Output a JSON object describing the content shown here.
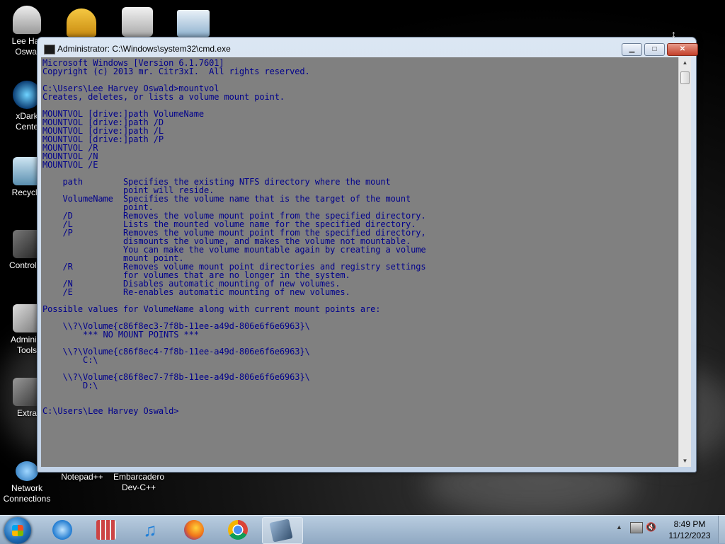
{
  "desktop": {
    "icons": [
      {
        "label": "Lee Har\nOswal",
        "icon": "user-folder-icon",
        "color": "#e6e6e6"
      },
      {
        "label": "xDark\nCente",
        "icon": "xdark-center-icon",
        "color": "#2a9bd6"
      },
      {
        "label": "Recycle",
        "icon": "recycle-bin-icon",
        "color": "#6aa9c9"
      },
      {
        "label": "Control P",
        "icon": "control-panel-icon",
        "color": "#444444"
      },
      {
        "label": "Administ\nTools",
        "icon": "admin-tools-icon",
        "color": "#888888"
      },
      {
        "label": "Extra",
        "icon": "extra-folder-icon",
        "color": "#555555"
      },
      {
        "label": "Network\nConnections",
        "icon": "network-connections-icon",
        "color": "#3c8fd6"
      },
      {
        "label": "Notepad++",
        "icon": "notepad-plus-plus-icon",
        "color": "#7cc576"
      },
      {
        "label": "Embarcadero\nDev-C++",
        "icon": "dev-cpp-icon",
        "color": "#d43c3c"
      }
    ]
  },
  "window": {
    "title": "Administrator: C:\\Windows\\system32\\cmd.exe",
    "minimize_label": "▁",
    "maximize_label": "□",
    "close_label": "✕"
  },
  "console": {
    "text": "Microsoft Windows [Version 6.1.7601]\nCopyright (c) 2013 mr. Citr3xI.  All rights reserved.\n\nC:\\Users\\Lee Harvey Oswald>mountvol\nCreates, deletes, or lists a volume mount point.\n\nMOUNTVOL [drive:]path VolumeName\nMOUNTVOL [drive:]path /D\nMOUNTVOL [drive:]path /L\nMOUNTVOL [drive:]path /P\nMOUNTVOL /R\nMOUNTVOL /N\nMOUNTVOL /E\n\n    path        Specifies the existing NTFS directory where the mount\n                point will reside.\n    VolumeName  Specifies the volume name that is the target of the mount\n                point.\n    /D          Removes the volume mount point from the specified directory.\n    /L          Lists the mounted volume name for the specified directory.\n    /P          Removes the volume mount point from the specified directory,\n                dismounts the volume, and makes the volume not mountable.\n                You can make the volume mountable again by creating a volume\n                mount point.\n    /R          Removes volume mount point directories and registry settings\n                for volumes that are no longer in the system.\n    /N          Disables automatic mounting of new volumes.\n    /E          Re-enables automatic mounting of new volumes.\n\nPossible values for VolumeName along with current mount points are:\n\n    \\\\?\\Volume{c86f8ec3-7f8b-11ee-a49d-806e6f6e6963}\\\n        *** NO MOUNT POINTS ***\n\n    \\\\?\\Volume{c86f8ec4-7f8b-11ee-a49d-806e6f6e6963}\\\n        C:\\\n\n    \\\\?\\Volume{c86f8ec7-7f8b-11ee-a49d-806e6f6e6963}\\\n        D:\\\n\n\nC:\\Users\\Lee Harvey Oswald>",
    "text_color": "#00008b",
    "background_color": "#808080"
  },
  "taskbar": {
    "pinned": [
      {
        "icon": "internet-explorer-icon",
        "color": "#2f8fe0"
      },
      {
        "icon": "archive-manager-icon",
        "color": "#b04848"
      },
      {
        "icon": "music-player-icon",
        "color": "#1f7fd8"
      },
      {
        "icon": "firefox-icon",
        "color": "#e8661c"
      },
      {
        "icon": "chrome-icon",
        "color": "#e2b21c"
      },
      {
        "icon": "cmd-window-icon",
        "color": "#4a6a8a"
      }
    ],
    "clock_time": "8:49 PM",
    "clock_date": "11/12/2023"
  }
}
